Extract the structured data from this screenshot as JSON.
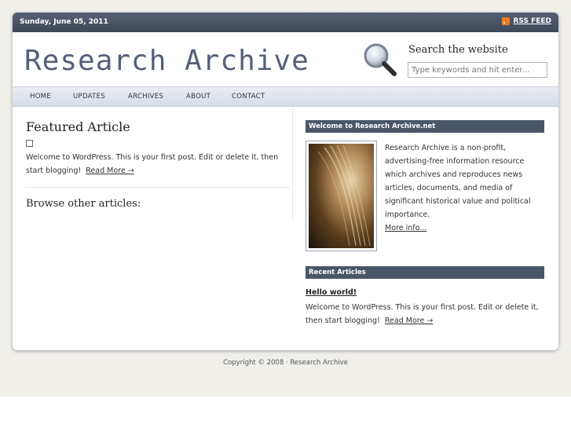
{
  "topbar": {
    "date": "Sunday, June 05, 2011",
    "rss_label": "RSS FEED"
  },
  "header": {
    "logo": "Research Archive",
    "search_title": "Search the website",
    "search_placeholder": "Type keywords and hit enter..."
  },
  "nav": {
    "items": [
      "HOME",
      "UPDATES",
      "ARCHIVES",
      "ABOUT",
      "CONTACT"
    ]
  },
  "featured": {
    "title": "Featured Article",
    "excerpt": "Welcome to WordPress. This is your first post. Edit or delete it, then start blogging!",
    "read_more": "Read More →",
    "browse_title": "Browse other articles:"
  },
  "sidebar": {
    "welcome_title": "Welcome to Research Archive.net",
    "about_text": "Research Archive is a non-profit, advertising-free information resource which archives and reproduces news articles, documents, and media of significant historical value and political importance.",
    "more_info": "More info...",
    "recent_title": "Recent Articles",
    "recent_post_title": "Hello world!",
    "recent_post_excerpt": "Welcome to WordPress. This is your first post. Edit or delete it, then start blogging!",
    "recent_read_more": "Read More →"
  },
  "footer": {
    "copyright": "Copyright © 2008 · Research Archive"
  },
  "colors": {
    "topbar": "#4a5568",
    "logo": "#55607a",
    "rss": "#f07a1e"
  }
}
